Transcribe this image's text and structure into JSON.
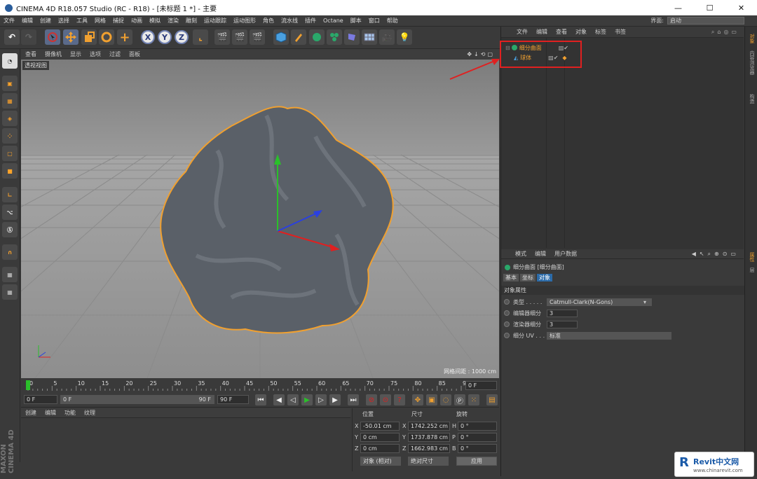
{
  "window": {
    "title": "CINEMA 4D R18.057 Studio (RC - R18) - [未标题 1 *] - 主要",
    "min": "—",
    "max": "☐",
    "close": "✕"
  },
  "menu": {
    "items": [
      "文件",
      "编辑",
      "创建",
      "选择",
      "工具",
      "网格",
      "捕捉",
      "动画",
      "模拟",
      "渲染",
      "雕刻",
      "运动跟踪",
      "运动图形",
      "角色",
      "流水线",
      "插件",
      "Octane",
      "脚本",
      "窗口",
      "帮助"
    ],
    "layout_label": "界面:",
    "layout_value": "启动"
  },
  "toolbar": {
    "undo": "↶",
    "axis_x": "X",
    "axis_y": "Y",
    "axis_z": "Z"
  },
  "viewport": {
    "menu": [
      "查看",
      "摄像机",
      "显示",
      "选项",
      "过滤",
      "面板"
    ],
    "label": "透视视图",
    "grid_spacing": "网格间距 : 1000 cm",
    "controls": "✥↓⟲▢"
  },
  "timeline": {
    "ticks": [
      "0",
      "5",
      "10",
      "15",
      "20",
      "25",
      "30",
      "35",
      "40",
      "45",
      "50",
      "55",
      "60",
      "65",
      "70",
      "75",
      "80",
      "85",
      "90"
    ],
    "end_frame": "0 F",
    "current_frame": 0,
    "total_frames": 90
  },
  "transport": {
    "start": "0 F",
    "range_start": "0 F",
    "range_end": "90 F",
    "end": "90 F"
  },
  "anim_panel": {
    "tabs": [
      "创建",
      "编辑",
      "功能",
      "纹理"
    ]
  },
  "coords": {
    "headers": [
      "位置",
      "尺寸",
      "旋转"
    ],
    "rows": [
      {
        "axis": "X",
        "pos": "-50.01 cm",
        "size_axis": "X",
        "size": "1742.252 cm",
        "rot_axis": "H",
        "rot": "0 °"
      },
      {
        "axis": "Y",
        "pos": "0 cm",
        "size_axis": "Y",
        "size": "1737.878 cm",
        "rot_axis": "P",
        "rot": "0 °"
      },
      {
        "axis": "Z",
        "pos": "0 cm",
        "size_axis": "Z",
        "size": "1662.983 cm",
        "rot_axis": "B",
        "rot": "0 °"
      }
    ],
    "mode": "对象 (相对)",
    "size_mode": "绝对尺寸",
    "apply": "应用"
  },
  "object_manager": {
    "menu": [
      "文件",
      "编辑",
      "查看",
      "对象",
      "标签",
      "书签"
    ],
    "objects": [
      {
        "name": "细分曲面",
        "level": 0
      },
      {
        "name": "球体",
        "level": 1
      }
    ]
  },
  "attribute_manager": {
    "menu": [
      "模式",
      "编辑",
      "用户数据"
    ],
    "object_title": "细分曲面 [细分曲面]",
    "tabs": [
      "基本",
      "坐标",
      "对象"
    ],
    "active_tab": "对象",
    "section": "对象属性",
    "props": [
      {
        "label": "类型 . . . . .",
        "value": "Catmull-Clark(N-Gons)"
      },
      {
        "label": "编辑器细分",
        "value": "3"
      },
      {
        "label": "渲染器细分",
        "value": "3"
      },
      {
        "label": "细分 UV . . .",
        "value": "标准"
      }
    ]
  },
  "right_tabs": [
    "对象",
    "内容浏览器",
    "构造"
  ],
  "right_tabs2": [
    "属性",
    "层"
  ],
  "maxon": "MAXON CINEMA 4D",
  "watermark": {
    "brand": "Revit中文网",
    "url": "www.chinarevit.com"
  },
  "colors": {
    "accent": "#e02020",
    "selection_orange": "#f0a030",
    "active_tab": "#2c6ba8"
  }
}
